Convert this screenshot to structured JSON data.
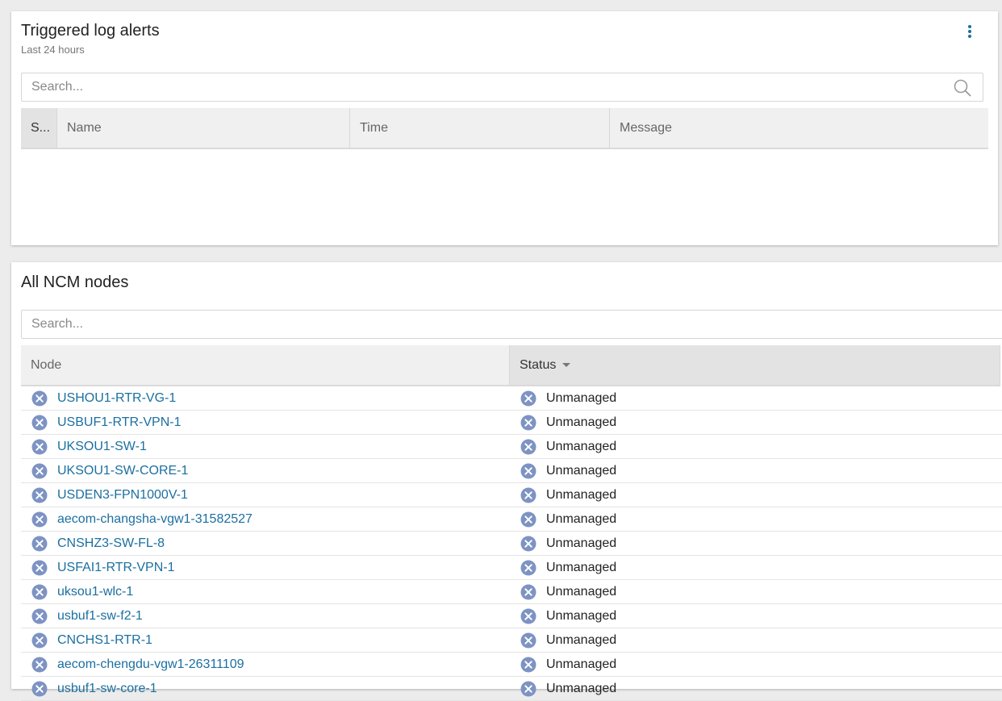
{
  "alerts": {
    "title": "Triggered log alerts",
    "subtitle": "Last 24 hours",
    "search_placeholder": "Search...",
    "columns": [
      "S...",
      "Name",
      "Time",
      "Message"
    ]
  },
  "nodes": {
    "title": "All NCM nodes",
    "search_placeholder": "Search...",
    "columns": [
      "Node",
      "Status"
    ],
    "sorted_column": "Status",
    "rows": [
      {
        "node": "USHOU1-RTR-VG-1",
        "status": "Unmanaged"
      },
      {
        "node": "USBUF1-RTR-VPN-1",
        "status": "Unmanaged"
      },
      {
        "node": "UKSOU1-SW-1",
        "status": "Unmanaged"
      },
      {
        "node": "UKSOU1-SW-CORE-1",
        "status": "Unmanaged"
      },
      {
        "node": "USDEN3-FPN1000V-1",
        "status": "Unmanaged"
      },
      {
        "node": "aecom-changsha-vgw1-31582527",
        "status": "Unmanaged"
      },
      {
        "node": "CNSHZ3-SW-FL-8",
        "status": "Unmanaged"
      },
      {
        "node": "USFAI1-RTR-VPN-1",
        "status": "Unmanaged"
      },
      {
        "node": "uksou1-wlc-1",
        "status": "Unmanaged"
      },
      {
        "node": "usbuf1-sw-f2-1",
        "status": "Unmanaged"
      },
      {
        "node": "CNCHS1-RTR-1",
        "status": "Unmanaged"
      },
      {
        "node": "aecom-chengdu-vgw1-26311109",
        "status": "Unmanaged"
      },
      {
        "node": "usbuf1-sw-core-1",
        "status": "Unmanaged"
      }
    ]
  },
  "colors": {
    "link": "#1b6fa0",
    "status_icon": "#7d93c3",
    "header_bg": "#f0f0f0",
    "panel_bg": "#ffffff",
    "page_bg": "#ececec"
  },
  "icons": {
    "menu": "kebab-menu-icon",
    "search": "search-icon",
    "status_unmanaged": "unmanaged-x-circle-icon",
    "sort": "sort-descending-icon"
  }
}
